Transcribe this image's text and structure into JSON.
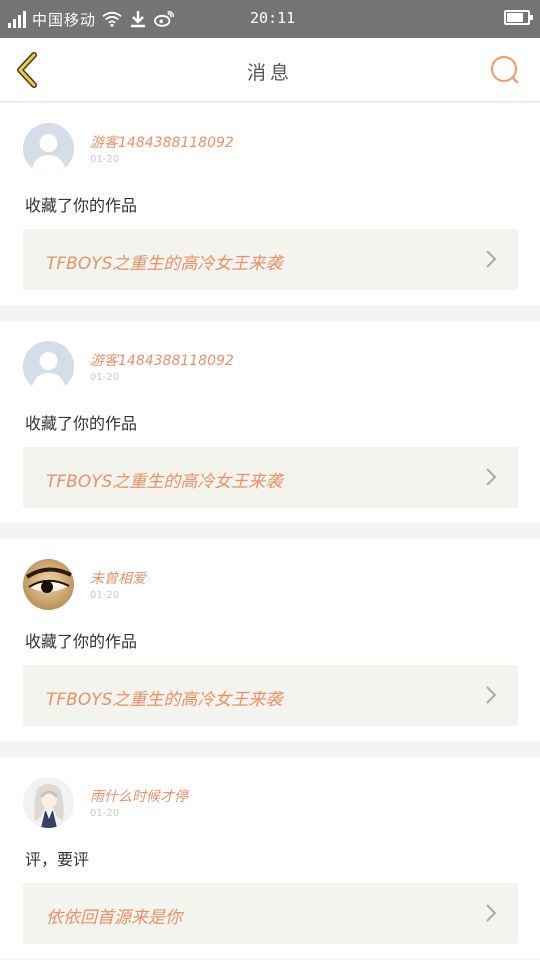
{
  "status_bar": {
    "carrier": "中国移动",
    "time": "20:11",
    "battery_level": 0.8,
    "icons": [
      "signal-icon",
      "wifi-icon",
      "download-icon",
      "weibo-icon",
      "battery-icon"
    ]
  },
  "header": {
    "title": "消息",
    "back_icon": "chevron-left-icon",
    "search_icon": "search-icon"
  },
  "colors": {
    "accent": "#e8916a",
    "back_arrow": "#f5c842",
    "status_bar": "#747474"
  },
  "messages": [
    {
      "user": "游客1484388118092",
      "date": "01-20",
      "action": "收藏了你的作品",
      "work": "TFBOYS之重生的高冷女王来袭",
      "avatar": "default-avatar"
    },
    {
      "user": "游客1484388118092",
      "date": "01-20",
      "action": "收藏了你的作品",
      "work": "TFBOYS之重生的高冷女王来袭",
      "avatar": "default-avatar"
    },
    {
      "user": "未曾相爱",
      "date": "01-20",
      "action": "收藏了你的作品",
      "work": "TFBOYS之重生的高冷女王来袭",
      "avatar": "eye-photo-avatar"
    },
    {
      "user": "雨什么时候才停",
      "date": "01-20",
      "action": "评，要评",
      "work": "依依回首源来是你",
      "avatar": "anime-girl-avatar"
    }
  ]
}
